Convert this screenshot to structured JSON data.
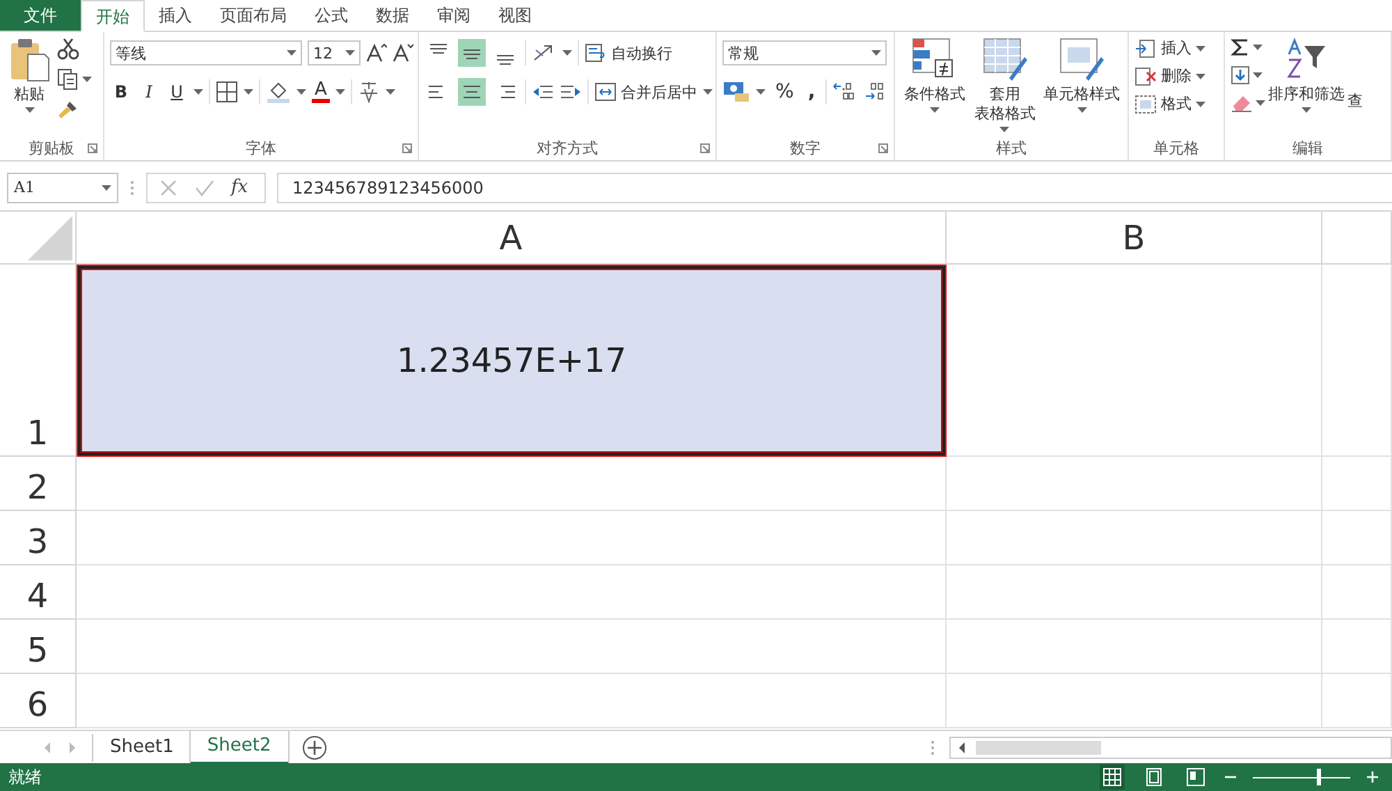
{
  "tabs": [
    {
      "label": "文件",
      "kind": "file",
      "selected": false
    },
    {
      "label": "开始",
      "kind": "tab",
      "selected": true
    },
    {
      "label": "插入",
      "kind": "tab",
      "selected": false
    },
    {
      "label": "页面布局",
      "kind": "tab",
      "selected": false
    },
    {
      "label": "公式",
      "kind": "tab",
      "selected": false
    },
    {
      "label": "数据",
      "kind": "tab",
      "selected": false
    },
    {
      "label": "审阅",
      "kind": "tab",
      "selected": false
    },
    {
      "label": "视图",
      "kind": "tab",
      "selected": false
    }
  ],
  "ribbon": {
    "clipboard": {
      "label": "剪贴板",
      "paste": "粘贴"
    },
    "font": {
      "label": "字体",
      "font_name": "等线",
      "size_field": "12",
      "bold": "B",
      "italic": "I",
      "underline": "U",
      "font_color": "A"
    },
    "alignment": {
      "label": "对齐方式",
      "vertical": [
        {
          "selected": false
        },
        {
          "selected": true
        },
        {
          "selected": false
        }
      ],
      "horizontal": [
        {
          "selected": false
        },
        {
          "selected": true
        },
        {
          "selected": false
        }
      ],
      "wrap_text": "自动换行",
      "merge_center": "合并后居中"
    },
    "number": {
      "label": "数字",
      "format": "常规",
      "percent": "%",
      "comma": ","
    },
    "styles": {
      "label": "样式",
      "buttons": [
        {
          "lines": [
            "条件格式"
          ]
        },
        {
          "lines": [
            "套用",
            "表格格式"
          ]
        },
        {
          "lines": [
            "单元格样式"
          ]
        }
      ]
    },
    "cells": {
      "label": "单元格",
      "buttons": [
        "插入",
        "删除",
        "格式"
      ]
    },
    "editing": {
      "label": "编辑",
      "sort_filter": "排序和筛选",
      "find": "查"
    }
  },
  "formula_bar": {
    "name_box": "A1",
    "fx": "fx",
    "formula": "123456789123456000"
  },
  "sheet": {
    "columns": [
      "A",
      "B"
    ],
    "rows": [
      {
        "header": "1",
        "cells": [
          {
            "value": "1.23457E+17",
            "selected": true,
            "highlighted": true
          }
        ]
      },
      {
        "header": "2"
      },
      {
        "header": "3"
      },
      {
        "header": "4"
      },
      {
        "header": "5"
      },
      {
        "header": "6"
      }
    ]
  },
  "sheet_tabs": [
    {
      "label": "Sheet1",
      "selected": false
    },
    {
      "label": "Sheet2",
      "selected": true
    }
  ],
  "status_bar": {
    "text": "就绪",
    "views": [
      {
        "selected": true
      },
      {
        "selected": false
      },
      {
        "selected": false
      }
    ],
    "zoom": {
      "level": 0.68
    }
  }
}
